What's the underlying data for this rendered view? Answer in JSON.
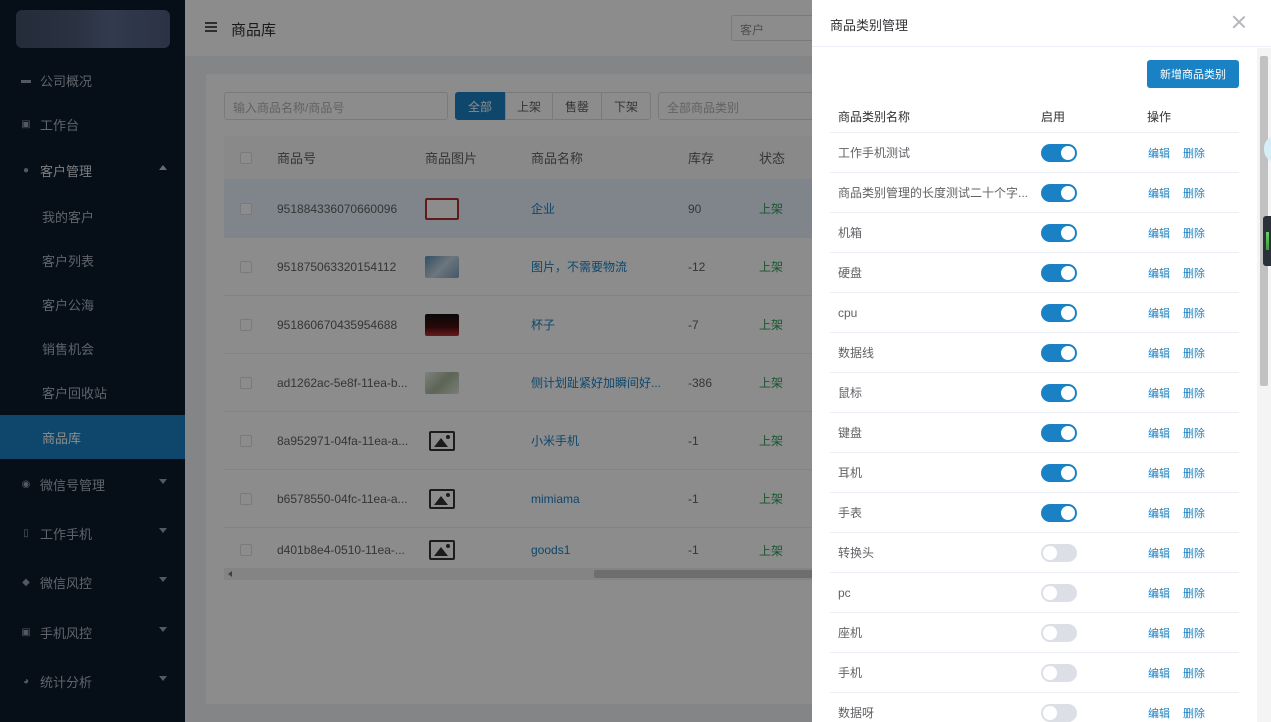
{
  "sidebar": {
    "items": [
      {
        "label": "公司概况",
        "icon": "monitor-icon"
      },
      {
        "label": "工作台",
        "icon": "desktop-icon"
      },
      {
        "label": "客户管理",
        "icon": "user-icon"
      },
      {
        "label": "我的客户"
      },
      {
        "label": "客户列表"
      },
      {
        "label": "客户公海"
      },
      {
        "label": "销售机会"
      },
      {
        "label": "客户回收站"
      },
      {
        "label": "商品库"
      },
      {
        "label": "微信号管理",
        "icon": "wechat-icon"
      },
      {
        "label": "工作手机",
        "icon": "phone-icon"
      },
      {
        "label": "微信风控",
        "icon": "shield-icon"
      },
      {
        "label": "手机风控",
        "icon": "phone-lock-icon"
      },
      {
        "label": "统计分析",
        "icon": "pie-chart-icon"
      }
    ],
    "accent": "#1a82c4"
  },
  "topbar": {
    "title": "商品库",
    "select_value": "客户"
  },
  "filters": {
    "search_placeholder": "输入商品名称/商品号",
    "segments": [
      "全部",
      "上架",
      "售罄",
      "下架"
    ],
    "category_placeholder": "全部商品类别"
  },
  "products": {
    "headers": [
      "商品号",
      "商品图片",
      "商品名称",
      "库存",
      "状态"
    ],
    "rows": [
      {
        "id": "951884336070660096",
        "name": "企业",
        "stock": "90",
        "status": "上架"
      },
      {
        "id": "951875063320154112",
        "name": "图片，不需要物流",
        "stock": "-12",
        "status": "上架"
      },
      {
        "id": "951860670435954688",
        "name": "杯子",
        "stock": "-7",
        "status": "上架"
      },
      {
        "id": "ad1262ac-5e8f-11ea-b...",
        "name": "侧计划趾紧好加瞬间好...",
        "stock": "-386",
        "status": "上架"
      },
      {
        "id": "8a952971-04fa-11ea-a...",
        "name": "小米手机",
        "stock": "-1",
        "status": "上架"
      },
      {
        "id": "b6578550-04fc-11ea-a...",
        "name": "mimiama",
        "stock": "-1",
        "status": "上架"
      },
      {
        "id": "d401b8e4-0510-11ea-...",
        "name": "goods1",
        "stock": "-1",
        "status": "上架"
      }
    ]
  },
  "drawer": {
    "title": "商品类别管理",
    "add_button": "新增商品类别",
    "headers": [
      "商品类别名称",
      "启用",
      "操作"
    ],
    "edit_label": "编辑",
    "delete_label": "删除",
    "categories": [
      {
        "name": "工作手机测试",
        "enabled": true
      },
      {
        "name": "商品类别管理的长度测试二十个字...",
        "enabled": true
      },
      {
        "name": "机箱",
        "enabled": true
      },
      {
        "name": "硬盘",
        "enabled": true
      },
      {
        "name": "cpu",
        "enabled": true
      },
      {
        "name": "数据线",
        "enabled": true
      },
      {
        "name": "鼠标",
        "enabled": true
      },
      {
        "name": "键盘",
        "enabled": true
      },
      {
        "name": "耳机",
        "enabled": true
      },
      {
        "name": "手表",
        "enabled": true
      },
      {
        "name": "转换头",
        "enabled": false
      },
      {
        "name": "pc",
        "enabled": false
      },
      {
        "name": "座机",
        "enabled": false
      },
      {
        "name": "手机",
        "enabled": false
      },
      {
        "name": "数据呀",
        "enabled": false
      }
    ]
  }
}
